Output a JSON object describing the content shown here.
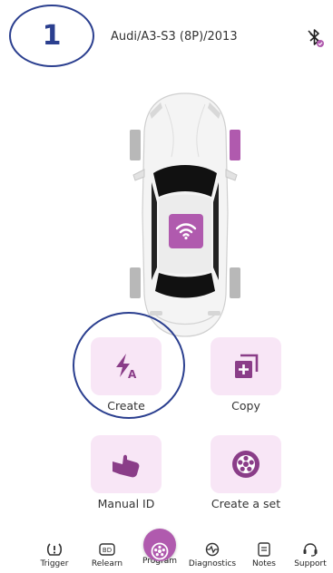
{
  "step_number": "1",
  "header": {
    "vehicle": "Audi/A3-S3 (8P)/2013"
  },
  "actions": [
    {
      "id": "create",
      "label": "Create"
    },
    {
      "id": "copy",
      "label": "Copy"
    },
    {
      "id": "manual_id",
      "label": "Manual ID"
    },
    {
      "id": "create_set",
      "label": "Create a set"
    }
  ],
  "nav": [
    {
      "label": "Trigger"
    },
    {
      "label": "Relearn"
    },
    {
      "label": "Program"
    },
    {
      "label": "Diagnostics"
    },
    {
      "label": "Notes"
    },
    {
      "label": "Support"
    }
  ],
  "colors": {
    "accent": "#b05aae",
    "tile": "#f8e6f6",
    "annotation": "#2b3f8f"
  }
}
